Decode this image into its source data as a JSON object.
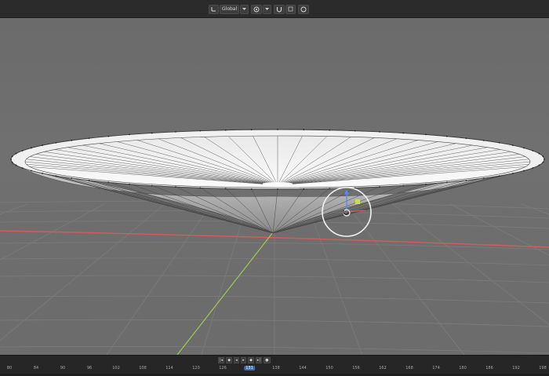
{
  "header": {
    "transform_orientation": "Global",
    "transform_orientation_icon": "axes-icon",
    "pivot_icon": "pivot-point-icon",
    "snap_icon": "magnet-icon",
    "proportional_icon": "circle-target-icon",
    "chevron_icon": "chevron-down-icon"
  },
  "timeline": {
    "current_frame": "131",
    "frame_labels": [
      "80",
      "84",
      "90",
      "96",
      "102",
      "108",
      "114",
      "120",
      "126",
      "131",
      "138",
      "144",
      "150",
      "156",
      "162",
      "168",
      "174",
      "180",
      "186",
      "192",
      "198"
    ],
    "controls_icons": [
      "jump-start-icon",
      "prev-keyframe-icon",
      "play-reverse-icon",
      "play-icon",
      "next-keyframe-icon",
      "jump-end-icon",
      "record-icon"
    ]
  },
  "colors": {
    "x_axis": "#d95a5a",
    "y_axis": "#9ccc4a",
    "z_gizmo": "#4d8cff",
    "y_gizmo_handle": "#c8e045",
    "mesh_face": "#f2f2f2",
    "grid_line": "#7c7c7c"
  }
}
